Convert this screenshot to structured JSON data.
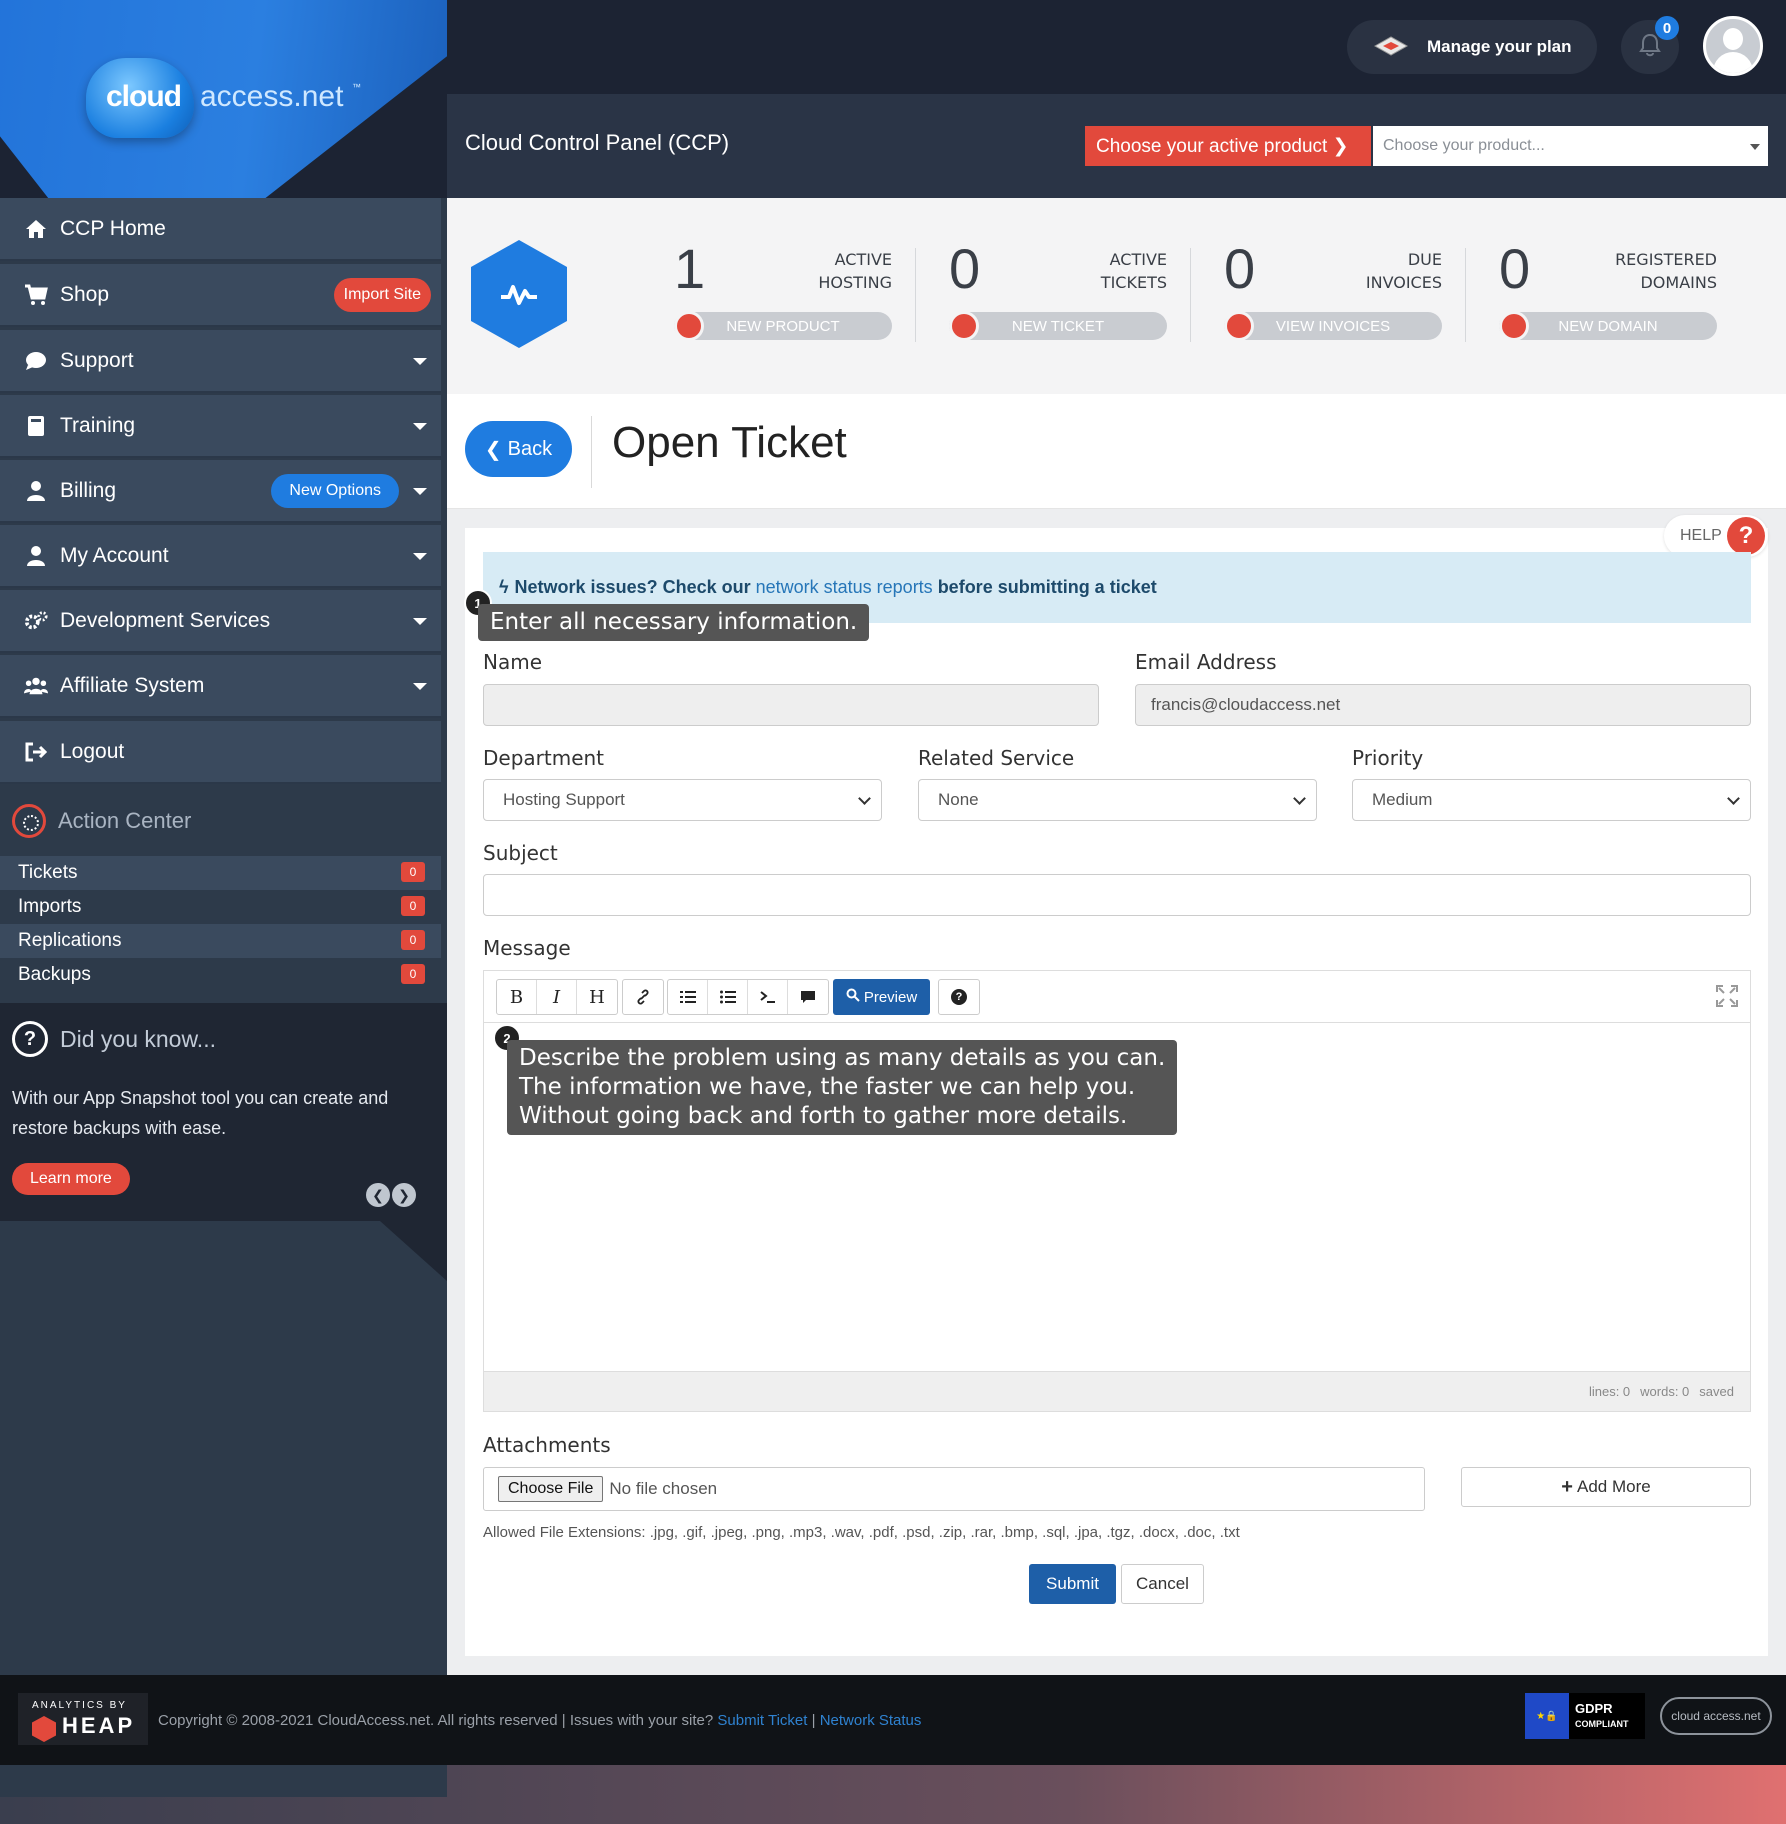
{
  "brand": {
    "logo_cloud": "cloud",
    "logo_domain": "access.net",
    "logo_tm": "™"
  },
  "topbar": {
    "manage_plan": "Manage your plan",
    "notification_count": "0"
  },
  "ccp": {
    "title": "Cloud Control Panel (CCP)",
    "choose_label": "Choose your active product ❯",
    "choose_placeholder": "Choose your product..."
  },
  "sidebar": {
    "items": [
      {
        "label": "CCP Home"
      },
      {
        "label": "Shop",
        "badge": "Import Site"
      },
      {
        "label": "Support"
      },
      {
        "label": "Training"
      },
      {
        "label": "Billing",
        "badge": "New Options"
      },
      {
        "label": "My Account"
      },
      {
        "label": "Development Services"
      },
      {
        "label": "Affiliate System"
      },
      {
        "label": "Logout"
      }
    ],
    "action_center": {
      "title": "Action Center",
      "rows": [
        {
          "label": "Tickets",
          "count": "0"
        },
        {
          "label": "Imports",
          "count": "0"
        },
        {
          "label": "Replications",
          "count": "0"
        },
        {
          "label": "Backups",
          "count": "0"
        }
      ]
    },
    "did_you_know": {
      "title": "Did you know...",
      "text": "With our App Snapshot tool you can create and restore backups with ease.",
      "button": "Learn more"
    }
  },
  "stats": [
    {
      "value": "1",
      "label_1": "ACTIVE",
      "label_2": "HOSTING",
      "button": "NEW PRODUCT"
    },
    {
      "value": "0",
      "label_1": "ACTIVE",
      "label_2": "TICKETS",
      "button": "NEW TICKET"
    },
    {
      "value": "0",
      "label_1": "DUE",
      "label_2": "INVOICES",
      "button": "VIEW INVOICES"
    },
    {
      "value": "0",
      "label_1": "REGISTERED",
      "label_2": "DOMAINS",
      "button": "NEW DOMAIN"
    }
  ],
  "page": {
    "back_label": "Back",
    "title": "Open Ticket",
    "help_label": "HELP"
  },
  "alert": {
    "prefix": "Network issues? Check our",
    "link": "network status reports",
    "suffix": "before submitting a ticket"
  },
  "tips": [
    {
      "number": "1",
      "text": "Enter all necessary information."
    },
    {
      "number": "2",
      "line_1": "Describe the problem using as many details as you can.",
      "line_2": "The information we have, the faster we can help you.",
      "line_3": "Without going back and forth to gather more details."
    }
  ],
  "form": {
    "name_label": "Name",
    "name_value": "",
    "email_label": "Email Address",
    "email_value": "francis@cloudaccess.net",
    "department_label": "Department",
    "department_value": "Hosting Support",
    "service_label": "Related Service",
    "service_value": "None",
    "priority_label": "Priority",
    "priority_value": "Medium",
    "subject_label": "Subject",
    "subject_value": "",
    "message_label": "Message",
    "toolbar": {
      "bold": "B",
      "italic": "I",
      "heading": "H",
      "preview": "Preview",
      "help": "?"
    },
    "status": {
      "lines": "lines: 0",
      "words": "words: 0",
      "saved": "saved"
    },
    "attachments_label": "Attachments",
    "choose_file": "Choose File",
    "no_file": "No file chosen",
    "add_more": "Add More",
    "allowed": "Allowed File Extensions: .jpg, .gif, .jpeg, .png, .mp3, .wav, .pdf, .psd, .zip, .rar, .bmp, .sql, .jpa, .tgz, .docx, .doc, .txt",
    "submit": "Submit",
    "cancel": "Cancel"
  },
  "footer": {
    "heap_small": "ANALYTICS BY",
    "heap_big": "HEAP",
    "copyright": "Copyright © 2008-2021 CloudAccess.net. All rights reserved | Issues with your site?",
    "submit_ticket": "Submit Ticket",
    "separator": "|",
    "network_status": "Network Status",
    "gdpr_1": "GDPR",
    "gdpr_2": "COMPLIANT",
    "logo_text": "cloud access.net"
  },
  "colors": {
    "accent_red": "#e2493c",
    "accent_blue": "#1f7ce0",
    "sidebar": "#3a4a5e",
    "topbar": "#1c2333"
  }
}
